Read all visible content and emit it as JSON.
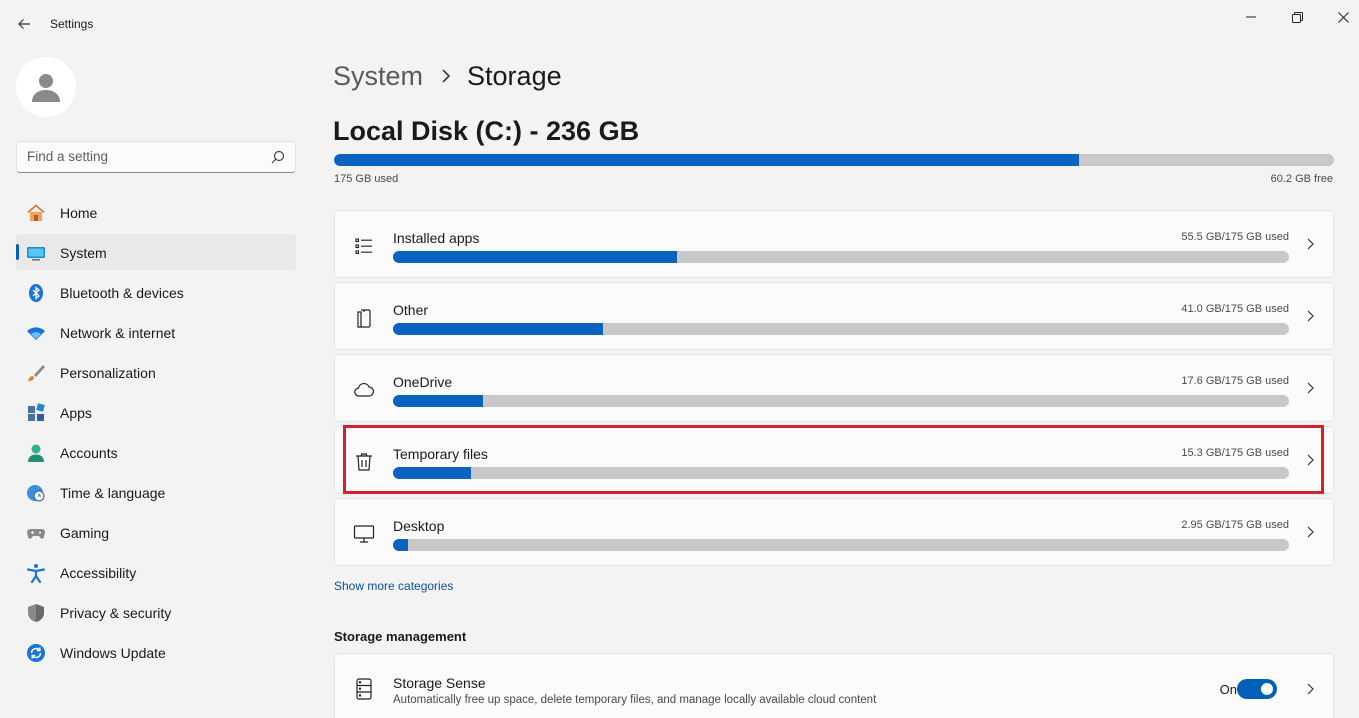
{
  "window": {
    "app_title": "Settings"
  },
  "sidebar": {
    "search_placeholder": "Find a setting",
    "items": [
      {
        "label": "Home",
        "icon": "home-icon",
        "active": false
      },
      {
        "label": "System",
        "icon": "system-monitor-icon",
        "active": true
      },
      {
        "label": "Bluetooth & devices",
        "icon": "bluetooth-icon",
        "active": false
      },
      {
        "label": "Network & internet",
        "icon": "wifi-icon",
        "active": false
      },
      {
        "label": "Personalization",
        "icon": "paintbrush-icon",
        "active": false
      },
      {
        "label": "Apps",
        "icon": "apps-grid-icon",
        "active": false
      },
      {
        "label": "Accounts",
        "icon": "person-icon",
        "active": false
      },
      {
        "label": "Time & language",
        "icon": "globe-clock-icon",
        "active": false
      },
      {
        "label": "Gaming",
        "icon": "gamepad-icon",
        "active": false
      },
      {
        "label": "Accessibility",
        "icon": "accessibility-icon",
        "active": false
      },
      {
        "label": "Privacy & security",
        "icon": "shield-icon",
        "active": false
      },
      {
        "label": "Windows Update",
        "icon": "update-icon",
        "active": false
      }
    ]
  },
  "breadcrumb": {
    "parent": "System",
    "current": "Storage"
  },
  "disk": {
    "title": "Local Disk (C:) - 236 GB",
    "used_label": "175 GB used",
    "free_label": "60.2 GB free",
    "used_fraction": 0.745
  },
  "categories": [
    {
      "name": "Installed apps",
      "usage": "55.5 GB/175 GB used",
      "fraction": 0.317,
      "icon": "list-icon"
    },
    {
      "name": "Other",
      "usage": "41.0 GB/175 GB used",
      "fraction": 0.234,
      "icon": "document-icon"
    },
    {
      "name": "OneDrive",
      "usage": "17.6 GB/175 GB used",
      "fraction": 0.1,
      "icon": "cloud-icon"
    },
    {
      "name": "Temporary files",
      "usage": "15.3 GB/175 GB used",
      "fraction": 0.087,
      "icon": "trash-icon"
    },
    {
      "name": "Desktop",
      "usage": "2.95 GB/175 GB used",
      "fraction": 0.017,
      "icon": "monitor-icon"
    }
  ],
  "show_more_label": "Show more categories",
  "storage_management": {
    "heading": "Storage management",
    "storage_sense": {
      "title": "Storage Sense",
      "description": "Automatically free up space, delete temporary files, and manage locally available cloud content",
      "state_label": "On",
      "enabled": true
    }
  },
  "colors": {
    "accent": "#005fb8",
    "bar_fill": "#0a63c1",
    "bar_track": "#c8c8c8",
    "highlight": "#d6202a"
  }
}
